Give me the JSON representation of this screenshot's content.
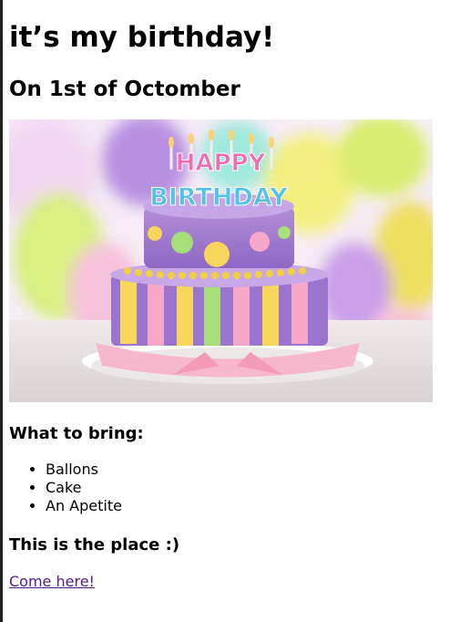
{
  "page": {
    "title": "it’s my birthday!",
    "subtitle": "On 1st of Octomber"
  },
  "bring_section": {
    "heading": "What to bring:",
    "items": [
      "Ballons",
      "Cake",
      "An Apetite"
    ]
  },
  "place_section": {
    "heading": "This is the place :)",
    "link_text": "Come here!"
  },
  "photo": {
    "topper_line_1": "HAPPY",
    "topper_line_2": "BIRTHDAY"
  },
  "colors": {
    "link": "#551a8b",
    "text": "#000000"
  }
}
